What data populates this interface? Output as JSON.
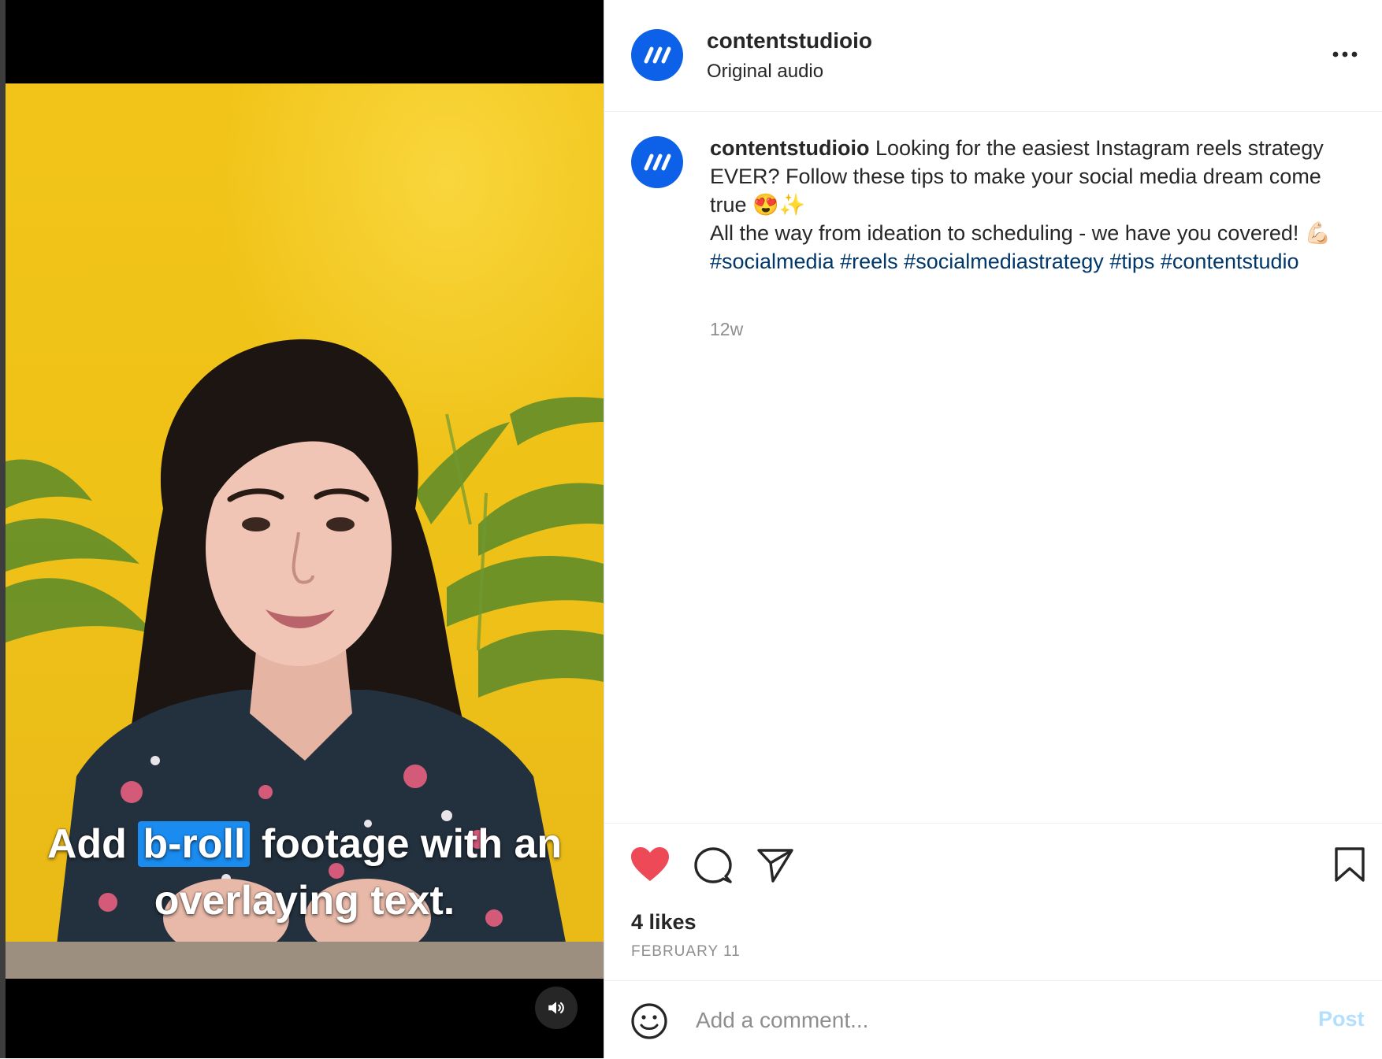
{
  "video": {
    "caption_before": "Add",
    "caption_highlight": "b-roll",
    "caption_after": "footage with an overlaying text.",
    "mute_icon": "volume-icon"
  },
  "header": {
    "username": "contentstudioio",
    "audio": "Original audio",
    "more_icon": "more-options-icon"
  },
  "post": {
    "username": "contentstudioio",
    "text_line1": "Looking for the easiest Instagram reels strategy EVER? Follow these tips to make your social media dream come true",
    "emoji1": "😍✨",
    "text_line2": "All the way from ideation to scheduling - we have you covered!",
    "emoji2": "💪🏻",
    "hashtags": [
      "#socialmedia",
      "#reels",
      "#socialmediastrategy",
      "#tips",
      "#contentstudio"
    ],
    "age": "12w"
  },
  "actions": {
    "likes": "4 likes",
    "date": "FEBRUARY 11"
  },
  "comment": {
    "placeholder": "Add a comment...",
    "post_label": "Post"
  },
  "colors": {
    "brand_avatar": "#0d61e8",
    "like_red": "#ed4956",
    "hashtag": "#00376b",
    "post_button_disabled": "#b2dffc",
    "caption_highlight": "#1a8cf0",
    "video_background": "#efc218"
  }
}
